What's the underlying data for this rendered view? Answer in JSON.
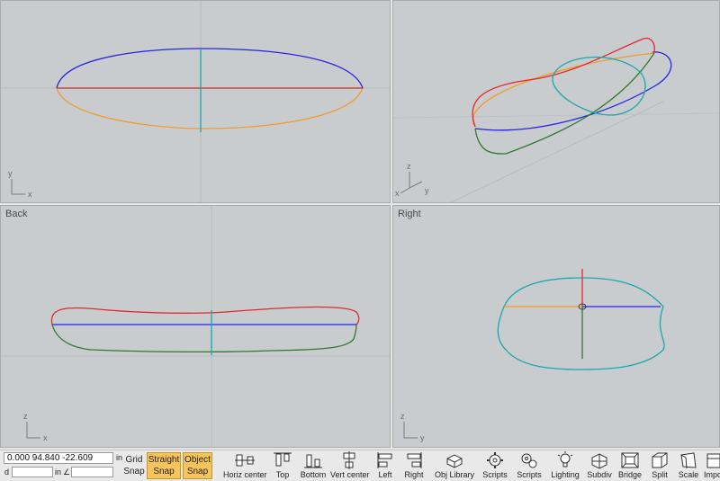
{
  "viewports": {
    "top": {
      "x_axis": "x",
      "y_axis": "y"
    },
    "perspective": {
      "z_axis": "z",
      "x_axis": "x",
      "y_axis": "y"
    },
    "back": {
      "title": "Back",
      "z_axis": "z",
      "x_axis": "x"
    },
    "right": {
      "title": "Right",
      "z_axis": "z",
      "y_axis": "y"
    }
  },
  "toolbar": {
    "coordinates": "0.000    94.840   -22.609",
    "unit": "in",
    "distance_label": "d",
    "distance_unit": "in",
    "angle_symbol": "∠",
    "grid_snap": [
      "Grid",
      "Snap"
    ],
    "straight_snap": [
      "Straight",
      "Snap"
    ],
    "object_snap": [
      "Object",
      "Snap"
    ],
    "tools": [
      {
        "label": "Horiz center",
        "icon": "horizontal-center-icon"
      },
      {
        "label": "Top",
        "icon": "align-top-icon"
      },
      {
        "label": "Bottom",
        "icon": "align-bottom-icon"
      },
      {
        "label": "Vert center",
        "icon": "vertical-center-icon"
      },
      {
        "label": "Left",
        "icon": "align-left-icon"
      },
      {
        "label": "Right",
        "icon": "align-right-icon"
      },
      {
        "label": "Obj Library",
        "icon": "object-library-icon"
      },
      {
        "label": "Scripts",
        "icon": "gear-icon"
      },
      {
        "label": "Scripts",
        "icon": "gears-icon"
      },
      {
        "label": "Lighting",
        "icon": "light-bulb-icon"
      },
      {
        "label": "Subdiv",
        "icon": "subdivide-icon"
      },
      {
        "label": "Bridge",
        "icon": "bridge-icon"
      },
      {
        "label": "Split",
        "icon": "split-icon"
      },
      {
        "label": "Scale",
        "icon": "scale-icon"
      },
      {
        "label": "Impo",
        "icon": "import-icon"
      }
    ]
  },
  "colors": {
    "viewport_bg": "#c9cccf",
    "curve_blue": "#2424e0",
    "curve_red": "#e02a2a",
    "curve_orange": "#f39a2e",
    "curve_green": "#2e7a2e",
    "curve_cyan": "#1aa8a8",
    "snap_active": "#f6c45a"
  }
}
